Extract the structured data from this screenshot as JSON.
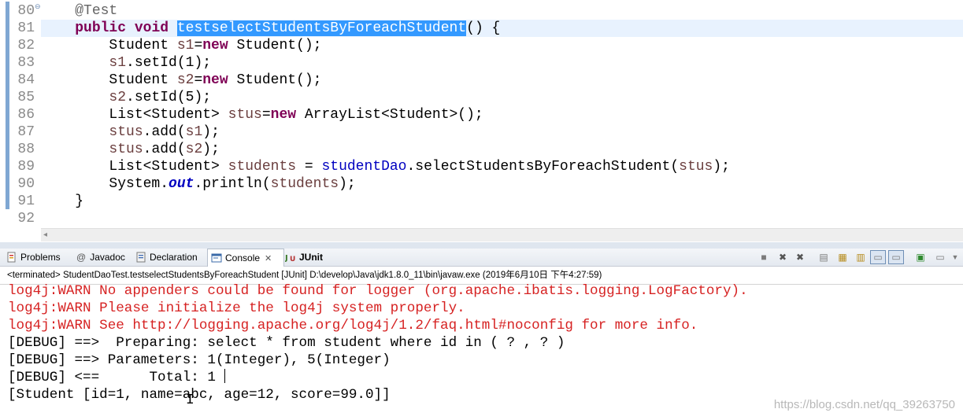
{
  "editor": {
    "lines": [
      {
        "num": "80",
        "segments": [
          {
            "t": "    ",
            "c": ""
          },
          {
            "t": "@Test",
            "c": "ann"
          }
        ]
      },
      {
        "num": "81",
        "segments": [
          {
            "t": "    ",
            "c": ""
          },
          {
            "t": "public",
            "c": "kw"
          },
          {
            "t": " ",
            "c": ""
          },
          {
            "t": "void",
            "c": "kw"
          },
          {
            "t": " ",
            "c": ""
          },
          {
            "t": "testselectStudentsByForeachStudent",
            "c": "sel"
          },
          {
            "t": "() {",
            "c": ""
          }
        ]
      },
      {
        "num": "82",
        "segments": [
          {
            "t": "        Student ",
            "c": ""
          },
          {
            "t": "s1",
            "c": "var"
          },
          {
            "t": "=",
            "c": ""
          },
          {
            "t": "new",
            "c": "kw"
          },
          {
            "t": " Student();",
            "c": ""
          }
        ]
      },
      {
        "num": "83",
        "segments": [
          {
            "t": "        ",
            "c": ""
          },
          {
            "t": "s1",
            "c": "var"
          },
          {
            "t": ".setId(1);",
            "c": ""
          }
        ]
      },
      {
        "num": "84",
        "segments": [
          {
            "t": "        Student ",
            "c": ""
          },
          {
            "t": "s2",
            "c": "var"
          },
          {
            "t": "=",
            "c": ""
          },
          {
            "t": "new",
            "c": "kw"
          },
          {
            "t": " Student();",
            "c": ""
          }
        ]
      },
      {
        "num": "85",
        "segments": [
          {
            "t": "        ",
            "c": ""
          },
          {
            "t": "s2",
            "c": "var"
          },
          {
            "t": ".setId(5);",
            "c": ""
          }
        ]
      },
      {
        "num": "86",
        "segments": [
          {
            "t": "        List<Student> ",
            "c": ""
          },
          {
            "t": "stus",
            "c": "var"
          },
          {
            "t": "=",
            "c": ""
          },
          {
            "t": "new",
            "c": "kw"
          },
          {
            "t": " ArrayList<Student>();",
            "c": ""
          }
        ]
      },
      {
        "num": "87",
        "segments": [
          {
            "t": "        ",
            "c": ""
          },
          {
            "t": "stus",
            "c": "var"
          },
          {
            "t": ".add(",
            "c": ""
          },
          {
            "t": "s1",
            "c": "var"
          },
          {
            "t": ");",
            "c": ""
          }
        ]
      },
      {
        "num": "88",
        "segments": [
          {
            "t": "        ",
            "c": ""
          },
          {
            "t": "stus",
            "c": "var"
          },
          {
            "t": ".add(",
            "c": ""
          },
          {
            "t": "s2",
            "c": "var"
          },
          {
            "t": ");",
            "c": ""
          }
        ]
      },
      {
        "num": "89",
        "segments": [
          {
            "t": "        List<Student> ",
            "c": ""
          },
          {
            "t": "students",
            "c": "var"
          },
          {
            "t": " = ",
            "c": ""
          },
          {
            "t": "studentDao",
            "c": "fld"
          },
          {
            "t": ".selectStudentsByForeachStudent(",
            "c": ""
          },
          {
            "t": "stus",
            "c": "var"
          },
          {
            "t": ");",
            "c": ""
          }
        ]
      },
      {
        "num": "90",
        "segments": [
          {
            "t": "        System.",
            "c": ""
          },
          {
            "t": "out",
            "c": "static-fld"
          },
          {
            "t": ".println(",
            "c": ""
          },
          {
            "t": "students",
            "c": "var"
          },
          {
            "t": ");",
            "c": ""
          }
        ]
      },
      {
        "num": "91",
        "segments": [
          {
            "t": "    }",
            "c": ""
          }
        ]
      },
      {
        "num": "92",
        "segments": [
          {
            "t": "",
            "c": ""
          }
        ]
      }
    ]
  },
  "tabs": {
    "problems": "Problems",
    "javadoc": "Javadoc",
    "declaration": "Declaration",
    "console": "Console",
    "console_close": "✕",
    "junit": "JUnit",
    "javadoc_icon": "@"
  },
  "console": {
    "header": "<terminated> StudentDaoTest.testselectStudentsByForeachStudent [JUnit] D:\\develop\\Java\\jdk1.8.0_11\\bin\\javaw.exe (2019年6月10日 下午4:27:59)",
    "lines": [
      {
        "text": "log4j:WARN No appenders could be found for logger (org.apache.ibatis.logging.LogFactory).",
        "kind": "warn"
      },
      {
        "text": "log4j:WARN Please initialize the log4j system properly.",
        "kind": "warn"
      },
      {
        "text": "log4j:WARN See http://logging.apache.org/log4j/1.2/faq.html#noconfig for more info.",
        "kind": "warn"
      },
      {
        "text": "[DEBUG] ==>  Preparing: select * from student where id in ( ? , ? )",
        "kind": "normal"
      },
      {
        "text": "[DEBUG] ==> Parameters: 1(Integer), 5(Integer)",
        "kind": "normal"
      },
      {
        "text": "[DEBUG] <==      Total: 1 ",
        "kind": "normal"
      },
      {
        "text": "[Student [id=1, name=abc, age=12, score=99.0]]",
        "kind": "normal"
      }
    ]
  },
  "watermark": "https://blog.csdn.net/qq_39263750",
  "colors": {
    "keyword": "#7f0055",
    "selection": "#3399ff",
    "warn": "#d62222",
    "field": "#0000c0"
  }
}
